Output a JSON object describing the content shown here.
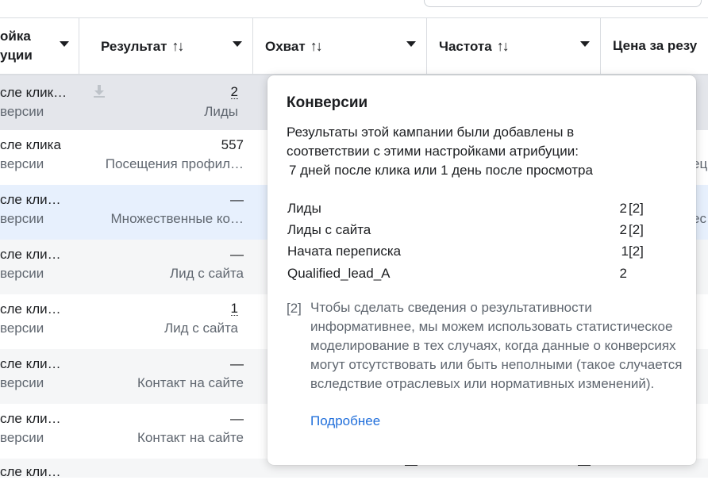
{
  "columns": [
    {
      "label_line1": "ойка",
      "label_line2": "уции",
      "caret": "chevron-down-icon"
    },
    {
      "label": "Результат",
      "sort": "↑↓",
      "caret": "chevron-down-icon"
    },
    {
      "label": "Охват",
      "sort": "↑↓",
      "caret": "chevron-down-icon"
    },
    {
      "label": "Частота",
      "sort": "↑↓",
      "caret": "chevron-down-icon"
    },
    {
      "label": "Цена за резу"
    }
  ],
  "rows": [
    {
      "attr_top": "сле клик…",
      "attr_bottom": "версии",
      "result_value": "2",
      "result_label": "Лиды",
      "icon": "download-icon"
    },
    {
      "attr_top": "сле клика",
      "attr_bottom": "версии",
      "result_value": "557",
      "result_label": "Посещения профил…",
      "edge": "ец"
    },
    {
      "attr_top": "сле кли…",
      "attr_bottom": "версии",
      "result_value": "—",
      "result_label": "Множественные ко…",
      "edge": "ес"
    },
    {
      "attr_top": "сле кли…",
      "attr_bottom": "версии",
      "result_value": "—",
      "result_label": "Лид с сайта"
    },
    {
      "attr_top": "сле кли…",
      "attr_bottom": "версии",
      "result_value": "1",
      "result_label": "Лид с сайта"
    },
    {
      "attr_top": "сле кли…",
      "attr_bottom": "версии",
      "result_value": "—",
      "result_label": "Контакт на сайте"
    },
    {
      "attr_top": "сле кли…",
      "attr_bottom": "версии",
      "result_value": "—",
      "result_label": "Контакт на сайте"
    },
    {
      "attr_top": "сле кли…"
    }
  ],
  "popover": {
    "title": "Конверсии",
    "intro_line1": "Результаты этой кампании были добавлены в",
    "intro_line2": "соответствии с этими настройками атрибуции:",
    "intro_line3": "7 дней после клика или 1 день после просмотра",
    "conversions": [
      {
        "name": "Лиды",
        "value": "2",
        "note": "[2]"
      },
      {
        "name": "Лиды с сайта",
        "value": "2",
        "note": "[2]"
      },
      {
        "name": "Начата переписка",
        "value": "1",
        "note": "[2]"
      },
      {
        "name": "Qualified_lead_A",
        "value": "2",
        "note": ""
      }
    ],
    "footnote_marker": "[2]",
    "footnote_text": "Чтобы сделать сведения о результативности информативнее, мы можем использовать статистическое моделирование в тех случаях, когда данные о конверсиях могут отсутствовать или быть неполными (такое случается вследствие отраслевых или нормативных изменений).",
    "more_link": "Подробнее"
  },
  "colors": {
    "link": "#216fdb",
    "muted": "#606770",
    "text": "#1c1e21",
    "highlight_row": "#e7f0fd",
    "grey_row": "#e4e6eb"
  }
}
